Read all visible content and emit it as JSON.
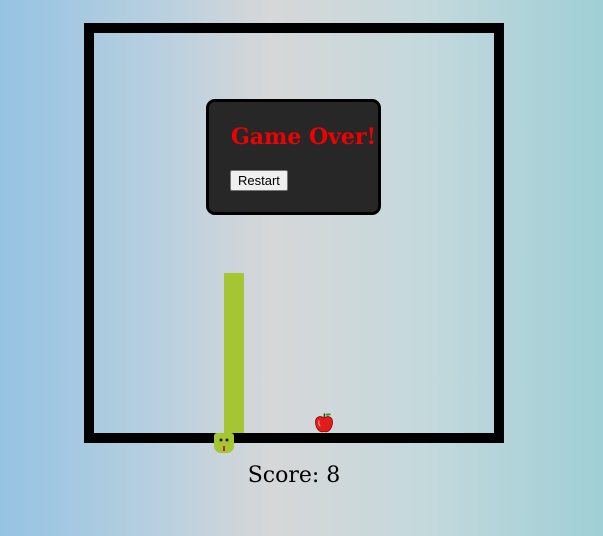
{
  "game_over": {
    "title": "Game Over!",
    "restart_label": "Restart"
  },
  "score": {
    "label": "Score:",
    "value": 8,
    "text": "Score: 8"
  },
  "colors": {
    "board_border": "#000000",
    "snake": "#a5c632",
    "panel_background": "#272727",
    "game_over_text": "#f00000",
    "apple": "#e31b1b"
  },
  "icons": {
    "snake_head": "snake-head-icon",
    "food": "apple-icon"
  }
}
